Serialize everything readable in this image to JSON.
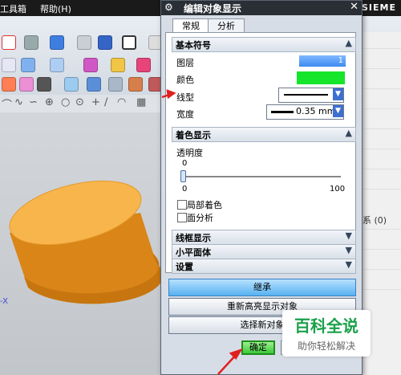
{
  "menubar": {
    "toolbox": "工具箱",
    "help": "帮助(H)",
    "brand": "SIEME"
  },
  "dialog": {
    "title": "编辑对象显示",
    "tabs": [
      "常规",
      "分析"
    ],
    "sections": {
      "basic": "基本符号",
      "shading": "着色显示",
      "wireframe": "线框显示",
      "facets": "小平面体",
      "settings": "设置"
    },
    "fields": {
      "layer_label": "图层",
      "layer_value": "1",
      "color_label": "颜色",
      "linetype_label": "线型",
      "width_label": "宽度",
      "width_value": "0.35 mm",
      "transparency_label": "透明度",
      "transparency_value": "0",
      "transparency_min": "0",
      "transparency_max": "100",
      "local_shading": "局部着色",
      "face_analysis": "面分析"
    },
    "buttons": {
      "inherit": "继承",
      "reselect": "重新高亮显示对象",
      "select_new": "选择新对象",
      "ok": "确定"
    },
    "colors": {
      "swatch": "#15e52b",
      "accent_arrow": "#e02020"
    }
  },
  "right_panel": {
    "text": "系 (0)"
  },
  "axis_label": "-X",
  "watermark": {
    "title": "百科全说",
    "subtitle": "助你轻松解决"
  }
}
